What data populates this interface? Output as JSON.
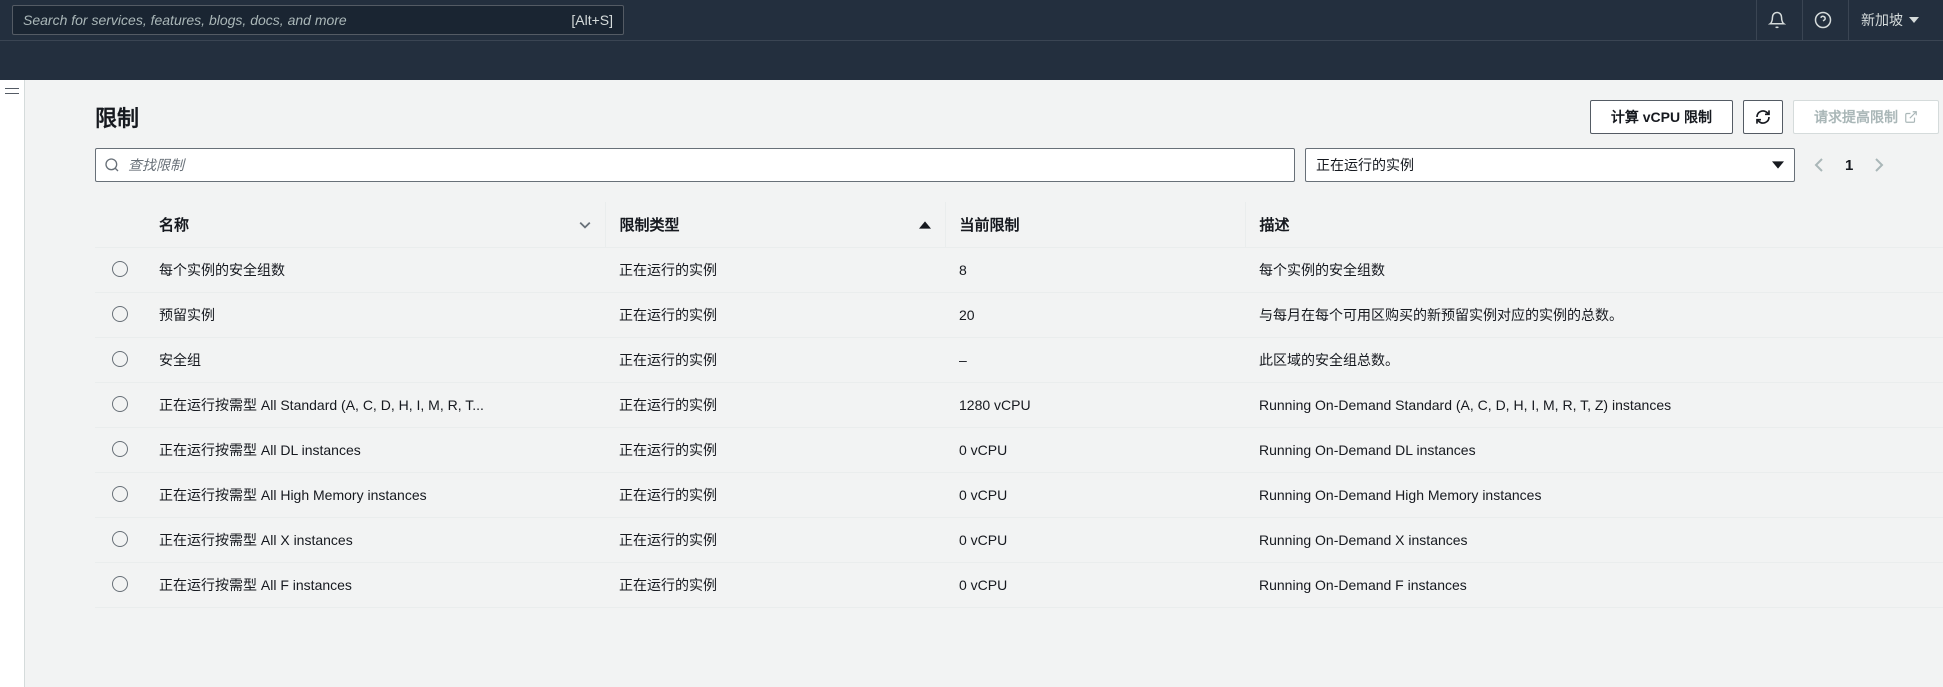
{
  "nav": {
    "search_placeholder": "Search for services, features, blogs, docs, and more",
    "shortcut": "[Alt+S]",
    "region": "新加坡"
  },
  "page": {
    "title": "限制",
    "calc_button": "计算 vCPU 限制",
    "request_increase": "请求提高限制"
  },
  "filter": {
    "search_placeholder": "查找限制",
    "select_value": "正在运行的实例"
  },
  "pager": {
    "page": "1"
  },
  "table": {
    "headers": {
      "name": "名称",
      "type": "限制类型",
      "current": "当前限制",
      "desc": "描述"
    },
    "rows": [
      {
        "name": "每个实例的安全组数",
        "type": "正在运行的实例",
        "limit": "8",
        "desc": "每个实例的安全组数"
      },
      {
        "name": "预留实例",
        "type": "正在运行的实例",
        "limit": "20",
        "desc": "与每月在每个可用区购买的新预留实例对应的实例的总数。"
      },
      {
        "name": "安全组",
        "type": "正在运行的实例",
        "limit": "–",
        "desc": "此区域的安全组总数。"
      },
      {
        "name": "正在运行按需型 All Standard (A, C, D, H, I, M, R, T...",
        "type": "正在运行的实例",
        "limit": "1280 vCPU",
        "desc": "Running On-Demand Standard (A, C, D, H, I, M, R, T, Z) instances"
      },
      {
        "name": "正在运行按需型 All DL instances",
        "type": "正在运行的实例",
        "limit": "0 vCPU",
        "desc": "Running On-Demand DL instances"
      },
      {
        "name": "正在运行按需型 All High Memory instances",
        "type": "正在运行的实例",
        "limit": "0 vCPU",
        "desc": "Running On-Demand High Memory instances"
      },
      {
        "name": "正在运行按需型 All X instances",
        "type": "正在运行的实例",
        "limit": "0 vCPU",
        "desc": "Running On-Demand X instances"
      },
      {
        "name": "正在运行按需型 All F instances",
        "type": "正在运行的实例",
        "limit": "0 vCPU",
        "desc": "Running On-Demand F instances"
      }
    ]
  }
}
